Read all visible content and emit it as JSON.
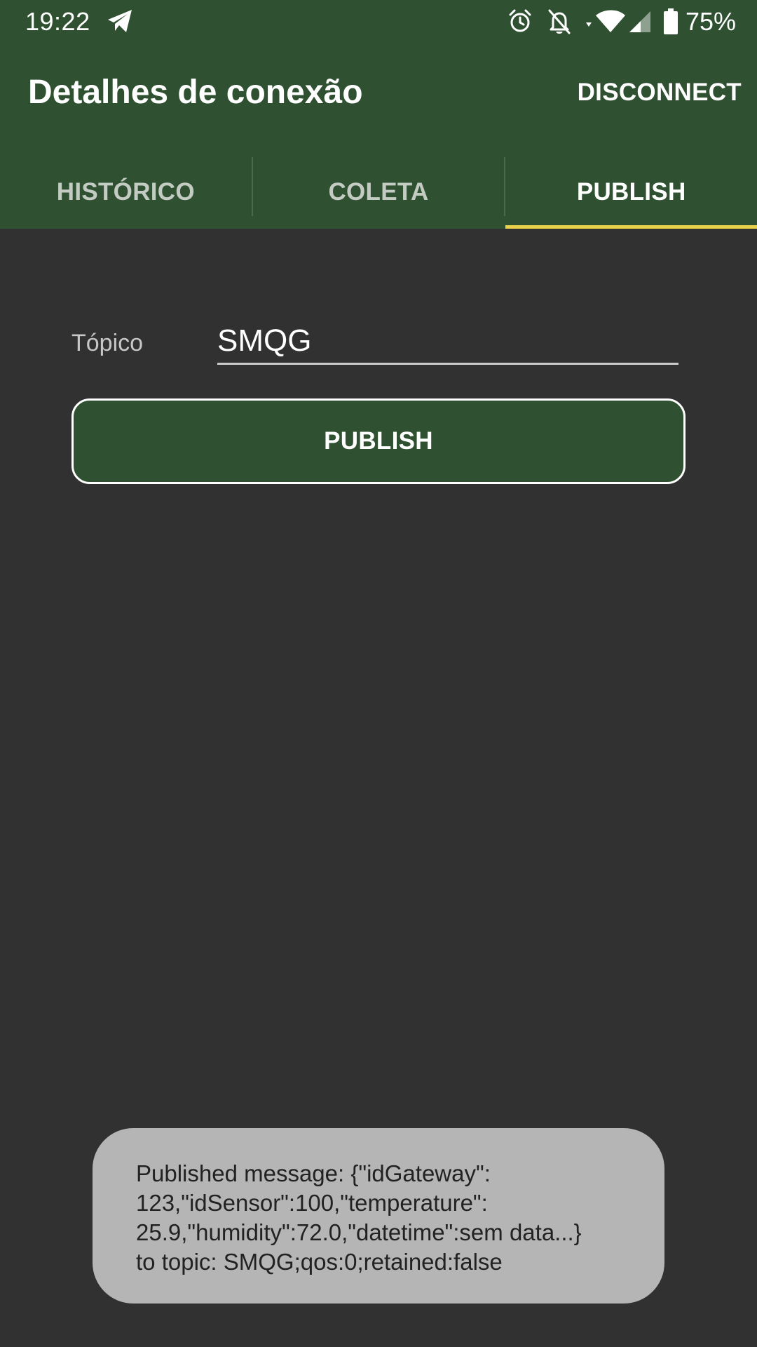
{
  "status_bar": {
    "time": "19:22",
    "battery_percent": "75%",
    "icons": [
      "telegram-icon",
      "alarm-icon",
      "notifications-off-icon",
      "wifi-icon",
      "cell-signal-icon",
      "battery-icon"
    ]
  },
  "toolbar": {
    "title": "Detalhes de conexão",
    "disconnect_label": "DISCONNECT"
  },
  "tabs": [
    {
      "label": "HISTÓRICO",
      "active": false
    },
    {
      "label": "COLETA",
      "active": false
    },
    {
      "label": "PUBLISH",
      "active": true
    }
  ],
  "form": {
    "topic_label": "Tópico",
    "topic_value": "SMQG",
    "publish_label": "PUBLISH"
  },
  "toast": {
    "lines": [
      "Published message: {\"idGateway\":",
      "123,\"idSensor\":100,\"temperature\":",
      "25.9,\"humidity\":72.0,\"datetime\":sem data...}",
      "to topic: SMQG;qos:0;retained:false"
    ]
  },
  "colors": {
    "app_bar": "#2f5131",
    "background": "#313131",
    "tab_indicator": "#e9d24a",
    "toast_background": "#b5b5b5"
  }
}
